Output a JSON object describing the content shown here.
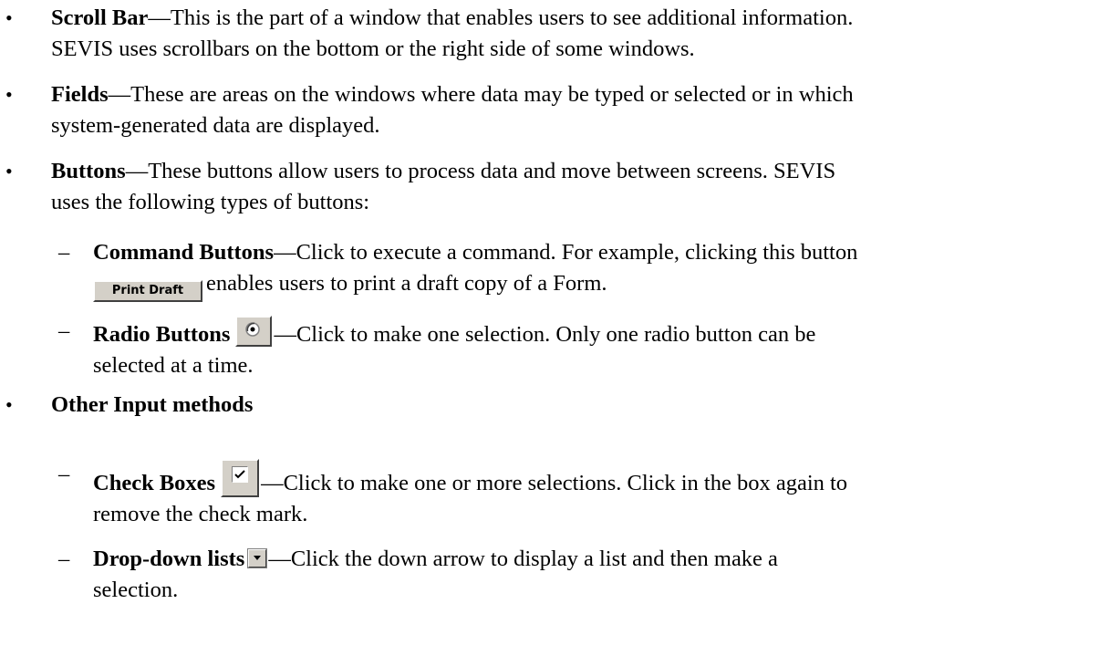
{
  "bullets": {
    "symbol": "•",
    "dash": "–"
  },
  "scroll_bar": {
    "term": "Scroll Bar",
    "line1": "—This is the part of a window that enables users to see additional information.",
    "line2": "SEVIS uses scrollbars on the bottom or the right side of some windows."
  },
  "fields": {
    "term": "Fields",
    "line1": "—These are areas on the windows where data may be typed or selected or in which",
    "line2": "system-generated data are displayed."
  },
  "buttons": {
    "term": "Buttons",
    "line1": "—These buttons allow users to process data and move between screens.  SEVIS",
    "line2": "uses the following types of buttons:"
  },
  "command_buttons": {
    "term": "Command Buttons",
    "line1": "—Click to execute a command.  For example, clicking this button",
    "button_label": "Print Draft",
    "line2": "enables users to print a draft copy of a Form."
  },
  "radio_buttons": {
    "term": "Radio Buttons",
    "line1": "—Click to make one selection.  Only one radio button can be",
    "line2": "selected at a time."
  },
  "other_input": {
    "term": "Other Input methods"
  },
  "check_boxes": {
    "term": "Check Boxes",
    "line1": "—Click to make one or more selections.  Click in the box again to",
    "line2": "remove the check mark."
  },
  "dropdown_lists": {
    "term": "Drop-down lists",
    "line1": "—Click the down arrow to display a list and then make a",
    "line2": "selection."
  },
  "icons": {
    "radio": "radio-button-selected-icon",
    "checkbox": "checkbox-checked-icon",
    "dropdown": "dropdown-arrow-icon"
  }
}
